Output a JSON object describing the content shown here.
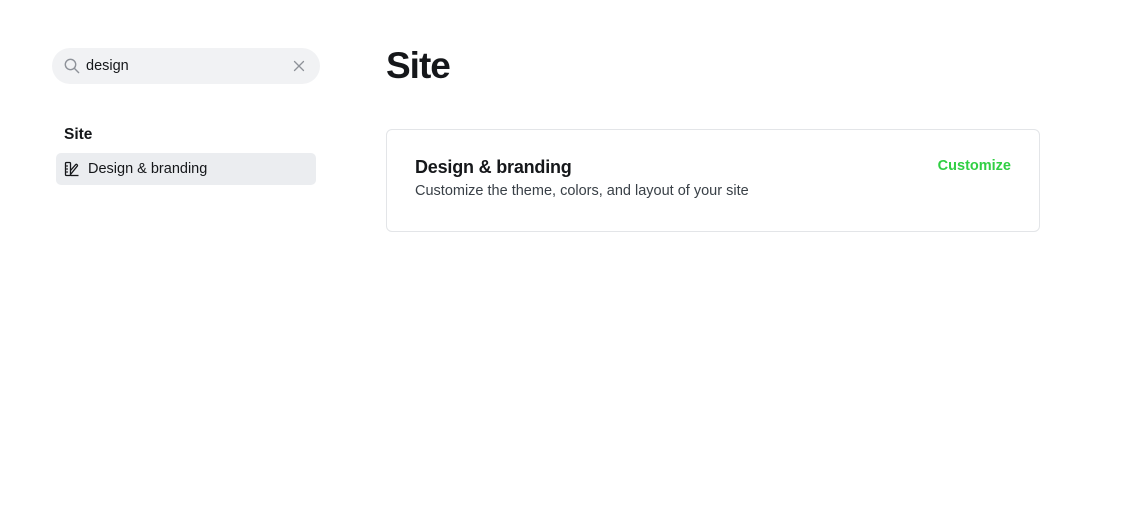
{
  "search": {
    "value": "design",
    "icon": "search-icon",
    "clear_icon": "close-icon"
  },
  "sidebar": {
    "section_title": "Site",
    "items": [
      {
        "label": "Design & branding",
        "icon": "paintbrush-icon",
        "active": true
      }
    ]
  },
  "main": {
    "title": "Site",
    "cards": [
      {
        "title": "Design & branding",
        "description": "Customize the theme, colors, and layout of your site",
        "action_label": "Customize"
      }
    ]
  },
  "colors": {
    "accent": "#30cf43",
    "search_bg": "#f1f2f4",
    "active_item_bg": "#ebedf0",
    "card_border": "#e3e5e8"
  }
}
